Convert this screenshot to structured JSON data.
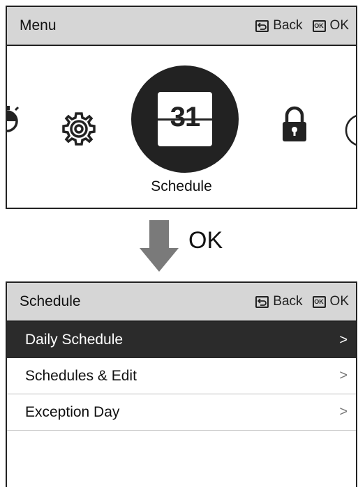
{
  "top_screen": {
    "header": {
      "title": "Menu",
      "back_label": "Back",
      "ok_label": "OK",
      "back_icon": "back-arrow-icon",
      "ok_icon": "ok-key-icon"
    },
    "carousel": {
      "items": [
        {
          "icon": "timer-icon"
        },
        {
          "icon": "gear-icon"
        },
        {
          "icon": "calendar-icon",
          "label": "Schedule",
          "number": "31",
          "selected": true
        },
        {
          "icon": "lock-icon"
        },
        {
          "icon": "circle-icon"
        }
      ]
    }
  },
  "transition": {
    "label": "OK",
    "icon": "down-arrow-icon"
  },
  "bottom_screen": {
    "header": {
      "title": "Schedule",
      "back_label": "Back",
      "ok_label": "OK"
    },
    "list": [
      {
        "label": "Daily Schedule",
        "selected": true
      },
      {
        "label": "Schedules & Edit",
        "selected": false
      },
      {
        "label": "Exception Day",
        "selected": false
      }
    ]
  },
  "colors": {
    "header_bg": "#d6d6d6",
    "selected_bg": "#2b2b2b",
    "border": "#222222"
  }
}
